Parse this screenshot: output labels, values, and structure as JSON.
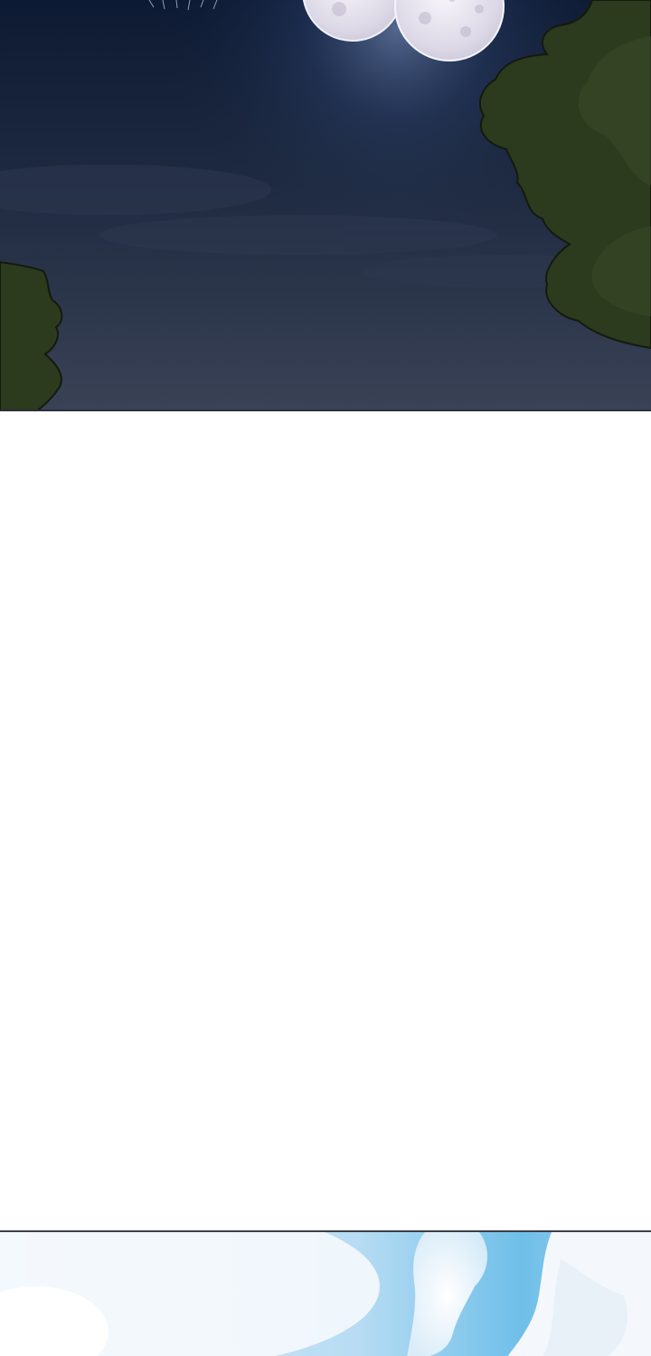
{
  "comic": {
    "panels": [
      {
        "scene": "night-sky",
        "elements": [
          "double-moon",
          "tree-foliage-right",
          "tree-foliage-left",
          "clouds"
        ]
      },
      {
        "scene": "blank-gutter"
      },
      {
        "scene": "day-sky",
        "elements": [
          "clouds",
          "blue-sky"
        ]
      }
    ]
  },
  "colors": {
    "night_sky_top": "#0d1a33",
    "night_sky_bottom": "#3a4256",
    "moon": "#e9e6ef",
    "foliage": "#2c3a1e",
    "day_sky": "#79c4ec",
    "cloud": "#f4f8fc",
    "panel_border": "#2b2f3a"
  }
}
